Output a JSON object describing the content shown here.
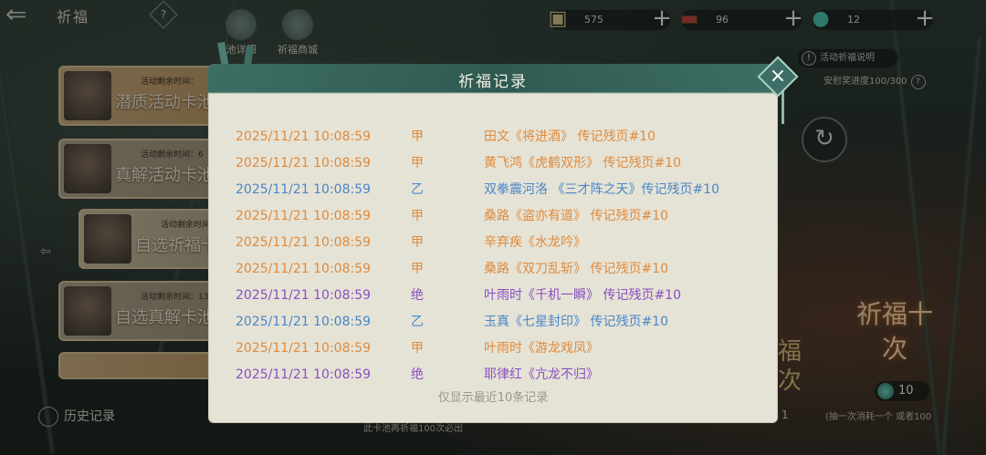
{
  "header": {
    "title": "祈福",
    "help": "?",
    "tabs": [
      {
        "label": "池详细"
      },
      {
        "label": "祈福商城"
      }
    ]
  },
  "resources": [
    {
      "icon": "silver-ingot-icon",
      "value": "575"
    },
    {
      "icon": "treasure-chest-icon",
      "value": "96"
    },
    {
      "icon": "jade-orb-icon",
      "value": "12"
    }
  ],
  "activities": [
    {
      "timer_label": "活动剩余时间：",
      "title": "潜质活动卡池"
    },
    {
      "timer_label": "活动剩余时间：6",
      "title": "真解活动卡池"
    },
    {
      "timer_label": "活动剩余时间",
      "title": "自选祈福卡池"
    },
    {
      "timer_label": "活动剩余时间：13",
      "title": "自选真解卡池"
    }
  ],
  "history_button": "历史记录",
  "bottom_note": "此卡池再祈福100次必出",
  "right_panel": {
    "explain": "活动祈福说明",
    "explain_icon": "!",
    "progress": "安慰奖进度100/300",
    "progress_help": "?",
    "pray_ten": "祈福十次",
    "peek_text": "福次",
    "peek_num": "1",
    "cost": "10",
    "cost_note": "(抽一次消耗一个 或者100"
  },
  "modal": {
    "title": "祈福记录",
    "records": [
      {
        "time": "2025/11/21 10:08:59",
        "grade": "甲",
        "item": "田文《将进酒》 传记残页#10",
        "color": "#e08a3c"
      },
      {
        "time": "2025/11/21 10:08:59",
        "grade": "甲",
        "item": "黄飞鸿《虎鹤双形》 传记残页#10",
        "color": "#e08a3c"
      },
      {
        "time": "2025/11/21 10:08:59",
        "grade": "乙",
        "item": "双拳震河洛 《三才阵之天》传记残页#10",
        "color": "#4a86c8"
      },
      {
        "time": "2025/11/21 10:08:59",
        "grade": "甲",
        "item": "桑路《盗亦有道》 传记残页#10",
        "color": "#e08a3c"
      },
      {
        "time": "2025/11/21 10:08:59",
        "grade": "甲",
        "item": "辛弃疾《水龙吟》",
        "color": "#e08a3c"
      },
      {
        "time": "2025/11/21 10:08:59",
        "grade": "甲",
        "item": "桑路《双刀乱斩》 传记残页#10",
        "color": "#e08a3c"
      },
      {
        "time": "2025/11/21 10:08:59",
        "grade": "绝",
        "item": "叶雨时《千机一瞬》 传记残页#10",
        "color": "#8a4fc0"
      },
      {
        "time": "2025/11/21 10:08:59",
        "grade": "乙",
        "item": "玉真《七星封印》 传记残页#10",
        "color": "#4a86c8"
      },
      {
        "time": "2025/11/21 10:08:59",
        "grade": "甲",
        "item": "叶雨时《游龙戏凤》",
        "color": "#e08a3c"
      },
      {
        "time": "2025/11/21 10:08:59",
        "grade": "绝",
        "item": "耶律红《亢龙不归》",
        "color": "#8a4fc0"
      }
    ],
    "footnote": "仅显示最近10条记录",
    "close": "×"
  }
}
